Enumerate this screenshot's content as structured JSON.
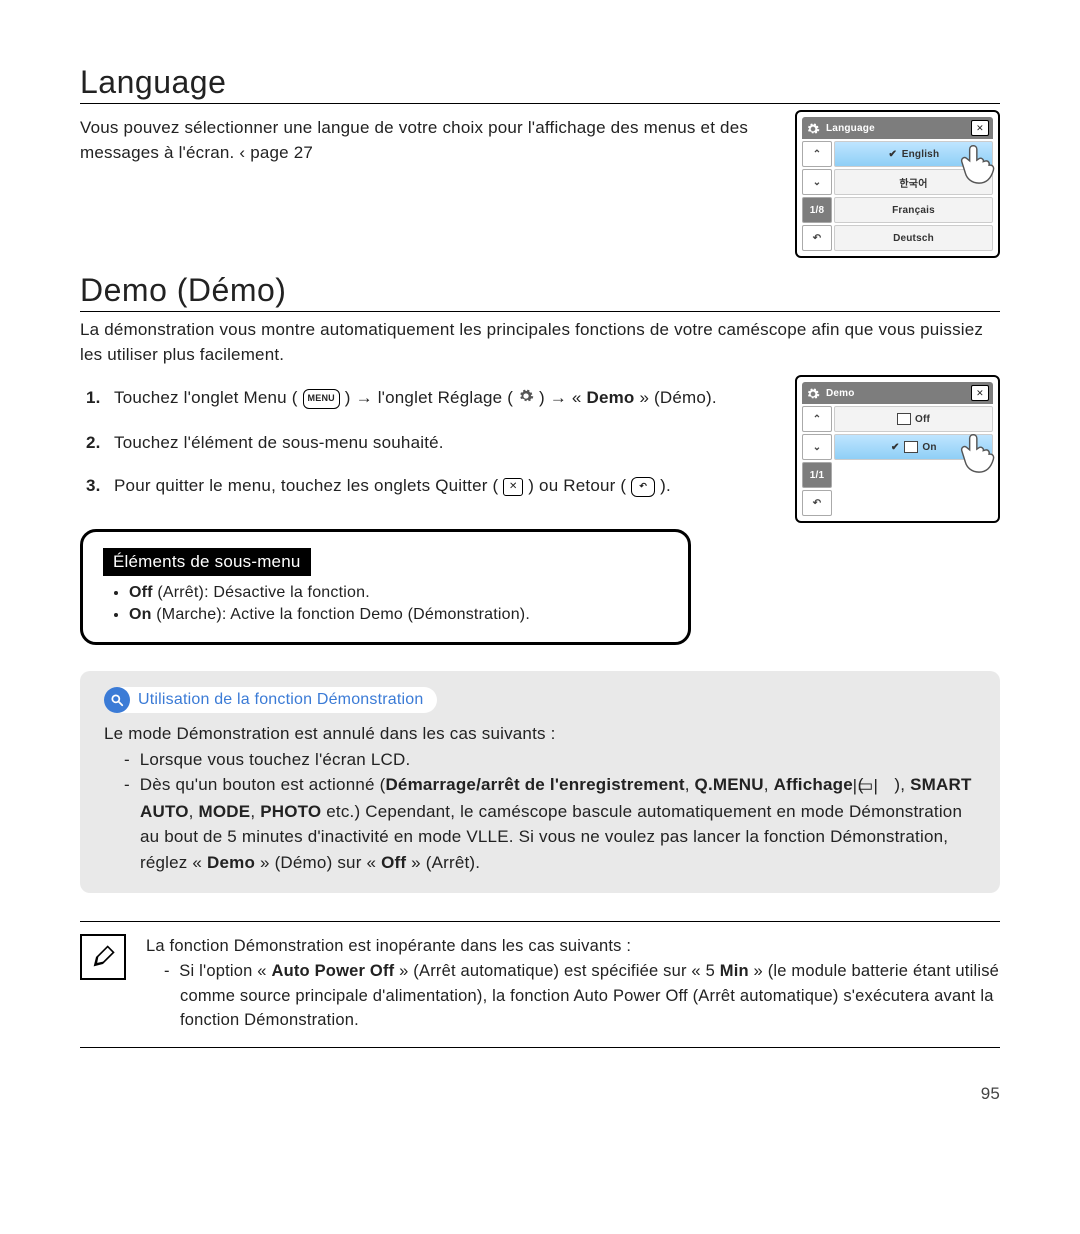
{
  "section1": {
    "title": "Language",
    "intro": "Vous pouvez sélectionner une langue de votre choix pour l'affichage des menus et des messages à l'écran. ",
    "page_ref_symbol": "‹",
    "page_ref": "page 27"
  },
  "lang_ui": {
    "title": "Language",
    "close": "✕",
    "nav": {
      "up": "⌃",
      "down": "⌄",
      "page": "1/8",
      "back": "↶"
    },
    "items": [
      {
        "label": "English",
        "selected": true,
        "checked": true
      },
      {
        "label": "한국어",
        "selected": false,
        "checked": false
      },
      {
        "label": "Français",
        "selected": false,
        "checked": false
      },
      {
        "label": "Deutsch",
        "selected": false,
        "checked": false
      }
    ]
  },
  "section2": {
    "title": "Demo (Démo)",
    "intro": "La démonstration vous montre automatiquement les principales fonctions de votre caméscope afin que vous puissiez les utiliser plus facilement."
  },
  "steps": {
    "s1a": "Touchez l'onglet Menu ( ",
    "s1b": " ) → l'onglet Réglage (",
    "s1c": ") → « ",
    "s1d": "Demo",
    "s1e": " » (Démo).",
    "s2": "Touchez l'élément de sous-menu souhaité.",
    "s3a": "Pour quitter le menu, touchez les onglets Quitter ( ",
    "s3b": " ) ou Retour ( ",
    "s3c": " )."
  },
  "menu_chip": "MENU",
  "demo_ui": {
    "title": "Demo",
    "close": "✕",
    "nav": {
      "up": "⌃",
      "down": "⌄",
      "page": "1/1",
      "back": "↶"
    },
    "items": [
      {
        "label": "Off",
        "selected": false,
        "checked": false
      },
      {
        "label": "On",
        "selected": true,
        "checked": true
      }
    ]
  },
  "submenu": {
    "heading": "Éléments de sous-menu",
    "items": [
      {
        "bold": "Off",
        "paren": " (Arrêt)",
        "rest": ": Désactive la fonction."
      },
      {
        "bold": "On",
        "paren": " (Marche)",
        "rest": ": Active la fonction Demo (Démonstration)."
      }
    ]
  },
  "tip": {
    "title": "Utilisation de la fonction Démonstration",
    "l1": "Le mode Démonstration est annulé dans les cas suivants :",
    "b1": "Lorsque vous touchez l'écran LCD.",
    "b2a": "Dès qu'un bouton est actionné (",
    "b2b": "Démarrage/arrêt de l'enregistrement",
    "b2c": ", ",
    "b2d": "Q.MENU",
    "b2e": ", ",
    "b2f": "Affichage",
    "b2g": " ( ",
    "b2h": " ), ",
    "b2i": "SMART AUTO",
    "b2j": ", ",
    "b2k": "MODE",
    "b2l": ", ",
    "b2m": "PHOTO",
    "b2n": " etc.) Cependant, le caméscope bascule automatiquement en mode Démonstration au bout de 5 minutes d'inactivité en mode VLLE. Si vous ne voulez pas lancer la fonction Démonstration, réglez « ",
    "b2o": "Demo",
    "b2p": " » (Démo) sur « ",
    "b2q": "Off",
    "b2r": " » (Arrêt)."
  },
  "warn": {
    "l1": "La fonction Démonstration est inopérante dans les cas suivants :",
    "b1a": "Si l'option « ",
    "b1b": "Auto Power Off",
    "b1c": " » (Arrêt automatique) est spécifiée sur « 5 ",
    "b1d": "Min",
    "b1e": " » (le module batterie étant utilisé comme source principale d'alimentation), la fonction Auto Power Off (Arrêt automatique) s'exécutera avant la fonction Démonstration."
  },
  "page_number": "95"
}
